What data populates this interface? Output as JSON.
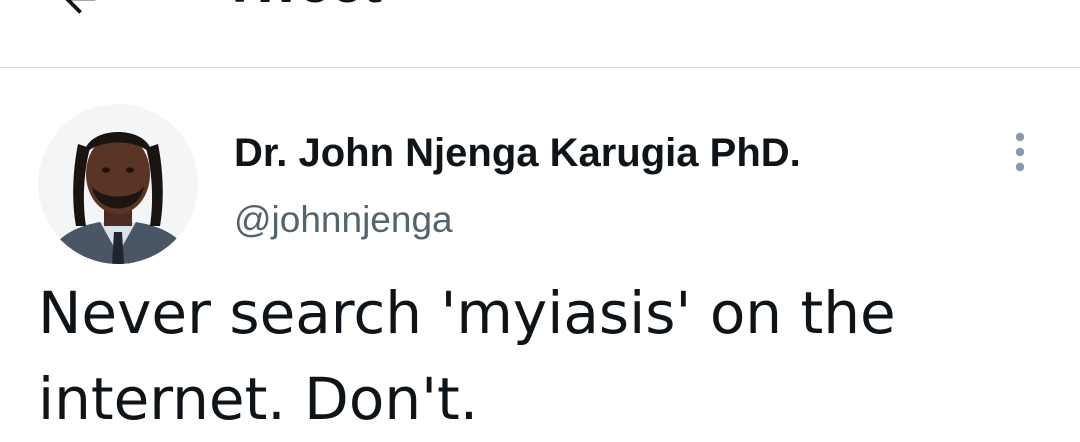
{
  "header": {
    "title": "Tweet",
    "back_icon": "arrow-left-icon"
  },
  "tweet": {
    "author": {
      "display_name": "Dr. John Njenga Karugia PhD.",
      "handle": "@johnnjenga",
      "avatar_icon": "avatar"
    },
    "more_icon": "more-vertical-icon",
    "text": "Never search 'myiasis' on the\ninternet. Don't."
  },
  "colors": {
    "text_primary": "#0f1419",
    "text_secondary": "#536471",
    "divider": "#dcdfe3",
    "more_icon": "#8b98a5"
  }
}
